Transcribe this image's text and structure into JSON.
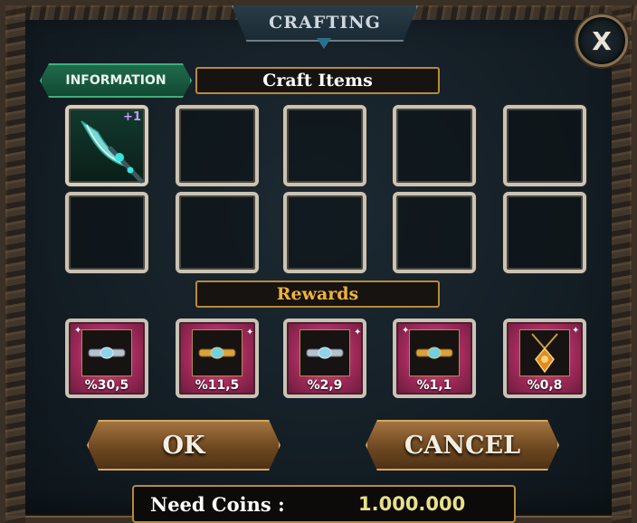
{
  "window": {
    "title": "CRAFTING",
    "close_label": "X"
  },
  "info_button": {
    "label": "INFORMATION"
  },
  "craft_section": {
    "header": "Craft Items",
    "slots": [
      {
        "filled": true,
        "item": "scythe-weapon",
        "enhance": "+1"
      },
      {
        "filled": false
      },
      {
        "filled": false
      },
      {
        "filled": false
      },
      {
        "filled": false
      },
      {
        "filled": false
      },
      {
        "filled": false
      },
      {
        "filled": false
      },
      {
        "filled": false
      },
      {
        "filled": false
      }
    ]
  },
  "rewards_section": {
    "header": "Rewards",
    "items": [
      {
        "icon": "silver-bracelet-icon",
        "chance": "%30,5"
      },
      {
        "icon": "gold-bracelet-icon",
        "chance": "%11,5"
      },
      {
        "icon": "silver-bracelet-icon",
        "chance": "%2,9"
      },
      {
        "icon": "gold-bracelet-icon",
        "chance": "%1,1"
      },
      {
        "icon": "amulet-icon",
        "chance": "%0,8"
      }
    ]
  },
  "actions": {
    "ok_label": "OK",
    "cancel_label": "CANCEL"
  },
  "coins": {
    "label": "Need Coins :",
    "value": "1.000.000"
  },
  "colors": {
    "accent_gold": "#b88a3a",
    "info_green": "#1f6a4b",
    "reward_pink": "#a02a5a",
    "coin_value": "#e8e08a"
  }
}
